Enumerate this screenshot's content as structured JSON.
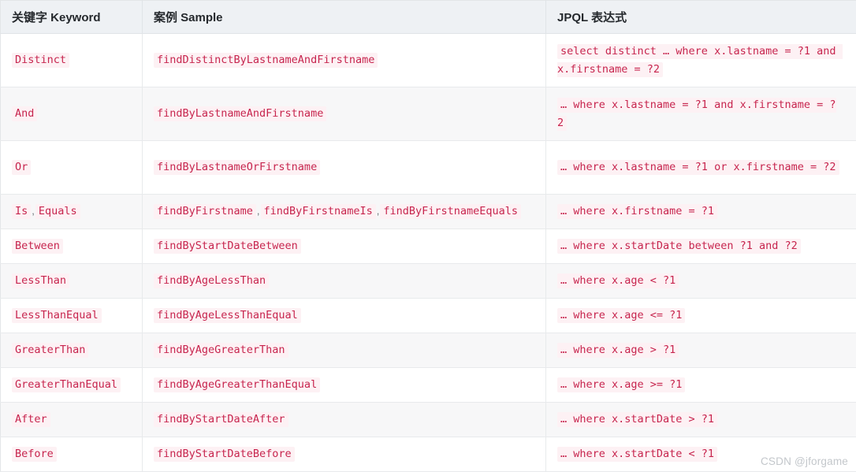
{
  "table": {
    "headers": [
      "关键字 Keyword",
      "案例 Sample",
      "JPQL 表达式"
    ],
    "rows": [
      {
        "keyword": [
          "Distinct"
        ],
        "sample": [
          "findDistinctByLastnameAndFirstname"
        ],
        "jpql": [
          "select distinct … where x.lastname = ?1 and x.firstname = ?2"
        ]
      },
      {
        "keyword": [
          "And"
        ],
        "sample": [
          "findByLastnameAndFirstname"
        ],
        "jpql": [
          "… where x.lastname = ?1 and x.firstname = ?2"
        ]
      },
      {
        "keyword": [
          "Or"
        ],
        "sample": [
          "findByLastnameOrFirstname"
        ],
        "jpql": [
          "… where x.lastname = ?1 or x.firstname = ?2"
        ]
      },
      {
        "keyword": [
          "Is",
          "Equals"
        ],
        "sample": [
          "findByFirstname",
          "findByFirstnameIs",
          "findByFirstnameEquals"
        ],
        "jpql": [
          "… where x.firstname = ?1"
        ]
      },
      {
        "keyword": [
          "Between"
        ],
        "sample": [
          "findByStartDateBetween"
        ],
        "jpql": [
          "… where x.startDate between ?1 and ?2"
        ]
      },
      {
        "keyword": [
          "LessThan"
        ],
        "sample": [
          "findByAgeLessThan"
        ],
        "jpql": [
          "… where x.age < ?1"
        ]
      },
      {
        "keyword": [
          "LessThanEqual"
        ],
        "sample": [
          "findByAgeLessThanEqual"
        ],
        "jpql": [
          "… where x.age <= ?1"
        ]
      },
      {
        "keyword": [
          "GreaterThan"
        ],
        "sample": [
          "findByAgeGreaterThan"
        ],
        "jpql": [
          "… where x.age > ?1"
        ]
      },
      {
        "keyword": [
          "GreaterThanEqual"
        ],
        "sample": [
          "findByAgeGreaterThanEqual"
        ],
        "jpql": [
          "… where x.age >= ?1"
        ]
      },
      {
        "keyword": [
          "After"
        ],
        "sample": [
          "findByStartDateAfter"
        ],
        "jpql": [
          "… where x.startDate > ?1"
        ]
      },
      {
        "keyword": [
          "Before"
        ],
        "sample": [
          "findByStartDateBefore"
        ],
        "jpql": [
          "… where x.startDate < ?1"
        ]
      }
    ]
  },
  "watermark": {
    "text": "CSDN @jforgame"
  },
  "colors": {
    "header_bg": "#eef1f4",
    "header_text": "#25292d",
    "row_shaded_bg": "#f7f7f8",
    "row_plain_bg": "#ffffff",
    "code_text": "#c7254e",
    "code_bg": "#fdf1f4",
    "border": "#e8eaec",
    "watermark_text": "#c3c7cb"
  },
  "separator": ","
}
